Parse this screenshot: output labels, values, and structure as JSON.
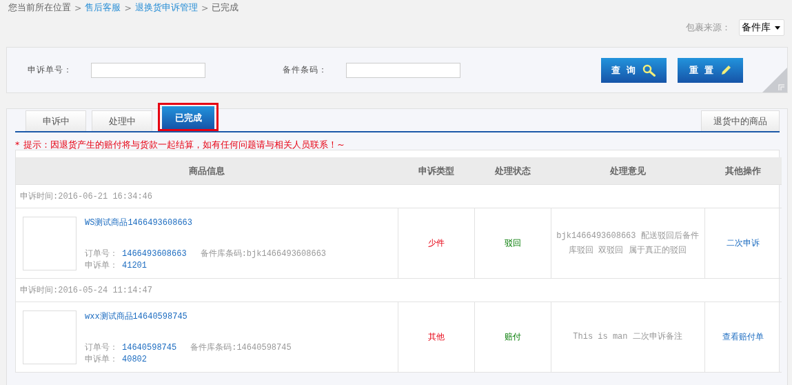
{
  "breadcrumb": [
    {
      "text": "您当前所在位置",
      "kind": "plain"
    },
    {
      "text": ">",
      "kind": "separator"
    },
    {
      "text": "售后客服",
      "kind": "link"
    },
    {
      "text": ">",
      "kind": "separator"
    },
    {
      "text": "退换货申诉管理",
      "kind": "link"
    },
    {
      "text": ">",
      "kind": "separator"
    },
    {
      "text": "已完成",
      "kind": "plain"
    }
  ],
  "source": {
    "label": "包裹来源：",
    "value": "备件库"
  },
  "search": {
    "fields": [
      {
        "label": "申诉单号："
      },
      {
        "label": "备件条码："
      }
    ],
    "buttons": [
      {
        "label": "查 询",
        "kind": "search"
      },
      {
        "label": "重 置",
        "kind": "reset"
      }
    ]
  },
  "tabs": [
    {
      "label": "申诉中",
      "selected": false
    },
    {
      "label": "处理中",
      "selected": false
    },
    {
      "label": "已完成",
      "selected": true
    }
  ],
  "side_tab": {
    "label": "退货中的商品"
  },
  "notice": {
    "mark": "*",
    "text": "提示：因退货产生的赔付将与货款一起结算，如有任何问题请与相关人员联系！~"
  },
  "table": {
    "columns": [
      "商品信息",
      "申诉类型",
      "处理状态",
      "处理意见",
      "其他操作"
    ],
    "rows": [
      {
        "time": "申诉时间:2016-06-21 16:34:46",
        "product": "WS测试商品1466493608663",
        "order_label": "订单号：",
        "order": "1466493608663",
        "code": "备件库条码:bjk1466493608663",
        "appeal_label": "申诉单：",
        "appeal": "41201",
        "type": "少件",
        "status": "驳回",
        "opinion": "bjk1466493608663 配送驳回后备件库驳回 双驳回 属于真正的驳回",
        "action": "二次申诉"
      },
      {
        "time": "申诉时间:2016-05-24 11:14:47",
        "product": "wxx测试商品14640598745",
        "order_label": "订单号：",
        "order": "14640598745",
        "code": "备件库条码:14640598745",
        "appeal_label": "申诉单：",
        "appeal": "40802",
        "type": "其他",
        "status": "赔付",
        "opinion": "This is man 二次申诉备注",
        "action": "查看赔付单"
      }
    ]
  }
}
